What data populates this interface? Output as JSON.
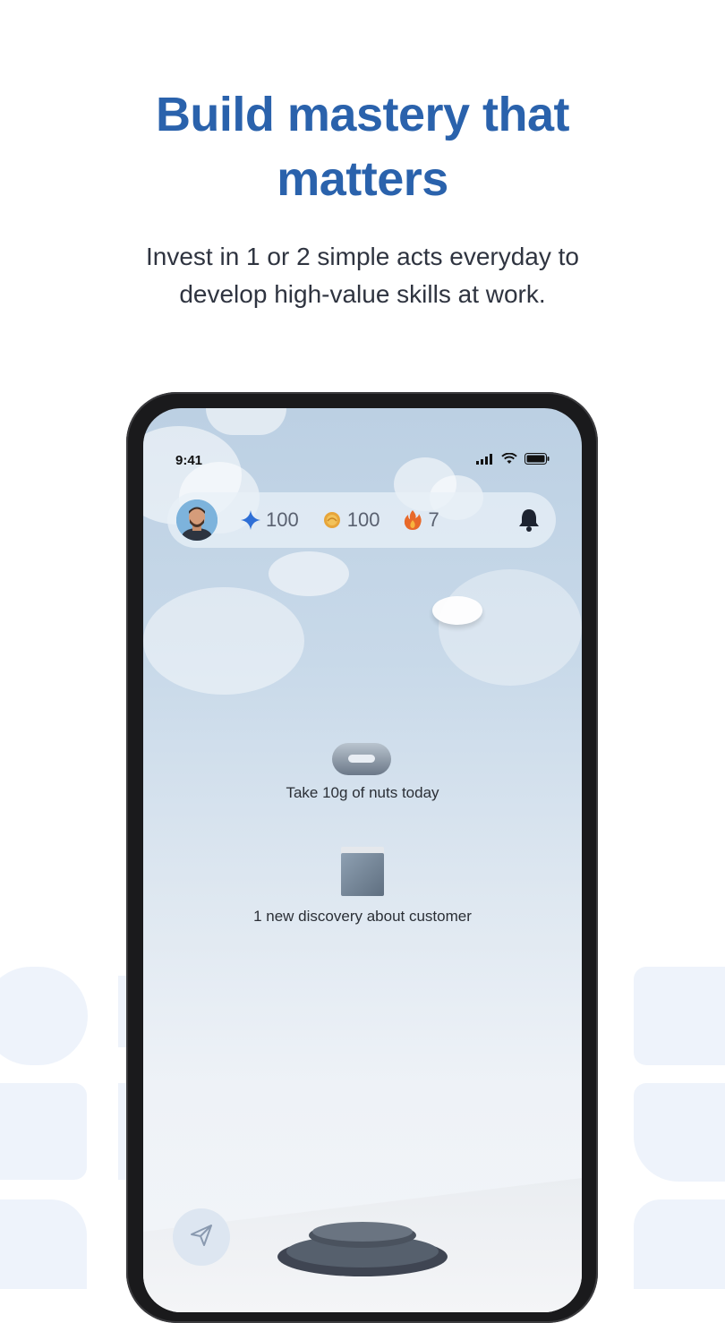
{
  "headline": {
    "line1": "Build mastery that",
    "line2": "matters"
  },
  "subheadline": {
    "line1": "Invest in 1 or 2 simple acts everyday to",
    "line2": "develop high-value skills  at work."
  },
  "phone": {
    "status_bar": {
      "time": "9:41"
    },
    "top_bar": {
      "stats": [
        {
          "icon": "sparkle-icon",
          "value": "100"
        },
        {
          "icon": "coin-icon",
          "value": "100"
        },
        {
          "icon": "flame-icon",
          "value": "7"
        }
      ]
    },
    "habits": [
      {
        "icon": "ring-icon",
        "label": "Take 10g of nuts today"
      },
      {
        "icon": "cube-icon",
        "label": "1 new discovery about customer"
      }
    ]
  },
  "colors": {
    "headline": "#2a62ac",
    "text": "#2f3440",
    "sparkle": "#2f6fd6",
    "coin": "#e7a53a",
    "flame": "#e8692a"
  }
}
